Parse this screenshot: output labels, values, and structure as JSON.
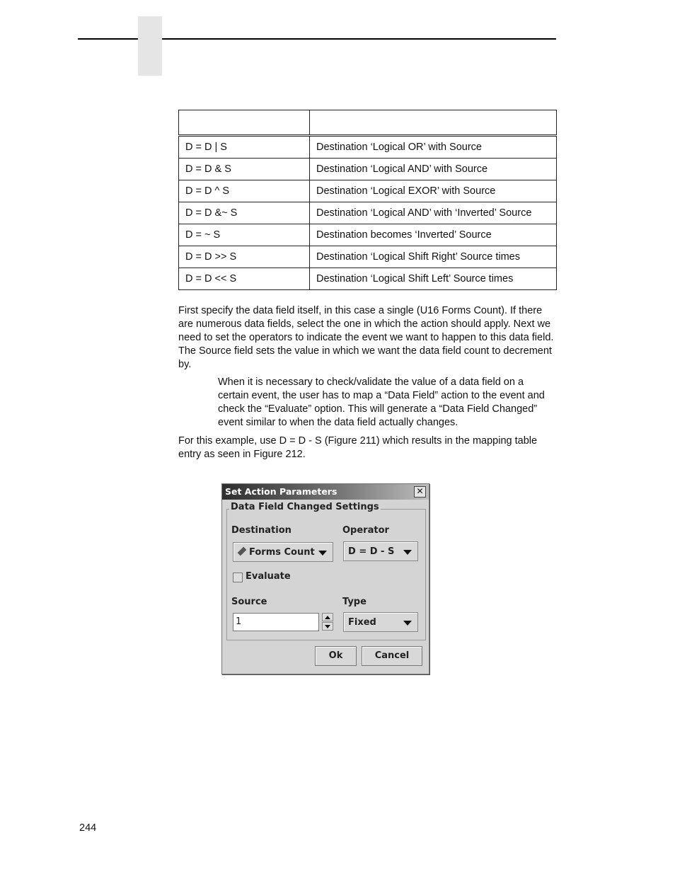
{
  "page": {
    "page_number": "244"
  },
  "table": {
    "headers": [
      "",
      ""
    ],
    "rows": [
      {
        "op": "D = D | S",
        "desc": "Destination ‘Logical OR’ with Source"
      },
      {
        "op": "D = D & S",
        "desc": "Destination ‘Logical AND’ with Source"
      },
      {
        "op": "D = D ^ S",
        "desc": "Destination ‘Logical EXOR’ with Source"
      },
      {
        "op": "D = D &~ S",
        "desc": "Destination ‘Logical AND’ with ‘Inverted’ Source"
      },
      {
        "op": "D = ~ S",
        "desc": "Destination becomes ‘Inverted’ Source"
      },
      {
        "op": "D = D >> S",
        "desc": "Destination ‘Logical Shift Right’ Source times"
      },
      {
        "op": "D = D << S",
        "desc": "Destination ‘Logical Shift Left’ Source times"
      }
    ]
  },
  "body": {
    "para1": "First specify the data field itself, in this case a single (U16 Forms Count). If there are numerous data fields, select the one in which the action should apply. Next we need to set the operators to indicate the event we want to happen to this data field. The Source field sets the value in which we want the data field count to decrement by.",
    "note": "When it is necessary to check/validate the value of a data field on a certain event, the user has to map a “Data Field” action to the event and check the “Evaluate” option. This will generate a “Data Field Changed” event similar to when the data field actually changes.",
    "para2": "For this example, use D = D - S (Figure 211) which results in the mapping table entry as seen in Figure 212."
  },
  "dialog": {
    "title": "Set Action Parameters",
    "close_glyph": "✕",
    "group_title": "Data Field Changed Settings",
    "destination_label": "Destination",
    "destination_value": "Forms Count",
    "destination_icon": "pencil-icon",
    "operator_label": "Operator",
    "operator_value": "D = D - S",
    "evaluate_label": "Evaluate",
    "evaluate_checked": false,
    "source_label": "Source",
    "source_value": "1",
    "type_label": "Type",
    "type_value": "Fixed",
    "ok_label": "Ok",
    "cancel_label": "Cancel"
  }
}
